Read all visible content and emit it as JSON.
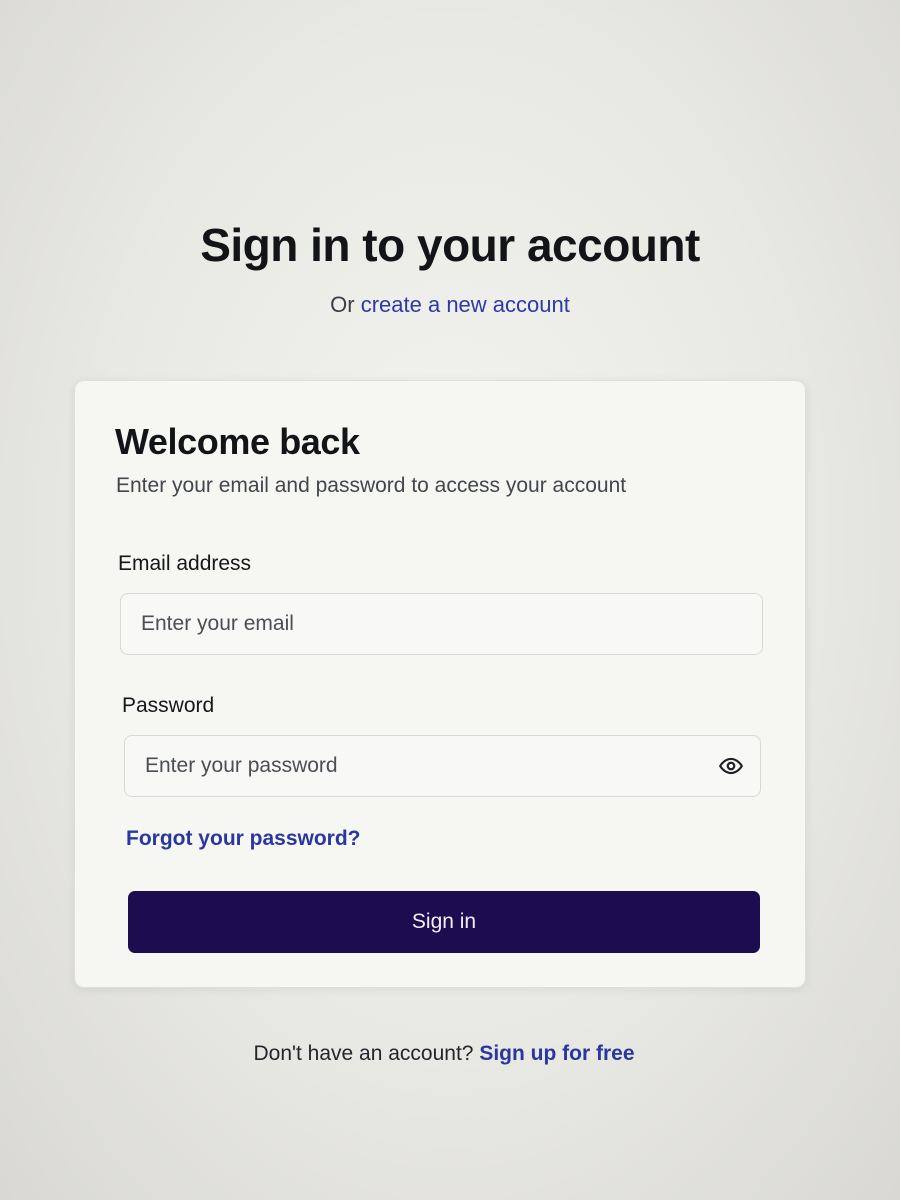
{
  "header": {
    "title": "Sign in to your account",
    "subtitle_prefix": "Or",
    "create_account_link": "create a new account"
  },
  "card": {
    "title": "Welcome back",
    "description": "Enter your email and password to access your account",
    "email": {
      "label": "Email address",
      "placeholder": "Enter your email",
      "value": ""
    },
    "password": {
      "label": "Password",
      "placeholder": "Enter your password",
      "value": "",
      "toggle_icon": "eye-icon"
    },
    "forgot_link": "Forgot your password?",
    "submit_label": "Sign in"
  },
  "footer": {
    "prompt": "Don't have an account?",
    "signup_link": "Sign up for free"
  },
  "colors": {
    "brand_button": "#1b0d4f",
    "link": "#2c3aa8",
    "background": "#ebebe6"
  }
}
